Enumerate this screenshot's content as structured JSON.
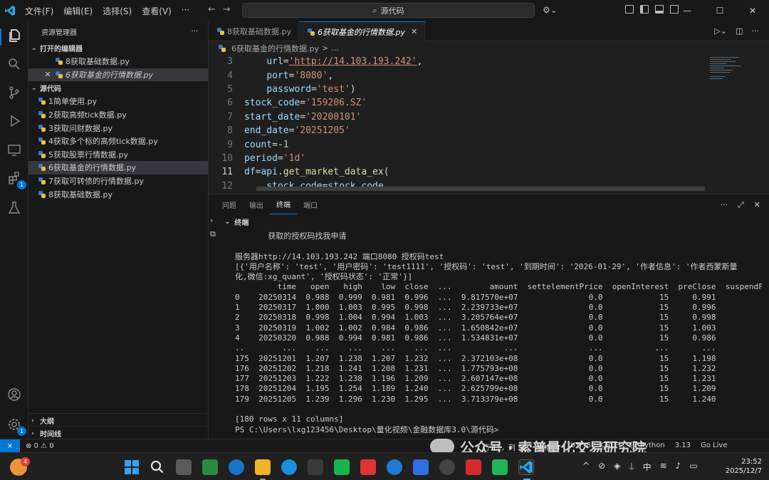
{
  "titlebar": {
    "menu": [
      "文件(F)",
      "编辑(E)",
      "选择(S)",
      "查看(V)",
      "···"
    ],
    "search_text": "源代码",
    "win_controls": [
      "—",
      "☐",
      "✕"
    ]
  },
  "sidebar": {
    "title": "资源管理器",
    "more": "···",
    "open_editors_label": "打开的编辑器",
    "open_editors": [
      {
        "name": "8获取基础数据.py"
      },
      {
        "name": "6获取基金的行情数据.py"
      }
    ],
    "folder_label": "源代码",
    "files": [
      "1简单使用.py",
      "2获取高频tick数据.py",
      "3获取问财数据.py",
      "4获取多个标的高频tick数据.py",
      "5获取股票行情数据.py",
      "6获取基金的行情数据.py",
      "7获取可转债的行情数据.py",
      "8获取基础数据.py"
    ],
    "outline_label": "大纲",
    "timeline_label": "时间线",
    "badges": {
      "extensions": "1",
      "settings": "1"
    }
  },
  "tabs": [
    {
      "label": "8获取基础数据.py",
      "active": false
    },
    {
      "label": "6获取基金的行情数据.py",
      "active": true,
      "close": "✕"
    }
  ],
  "breadcrumb": {
    "file": "6获取基金的行情数据.py",
    "sep": ">",
    "rest": "..."
  },
  "editor": {
    "lines": [
      {
        "n": "3",
        "indent": "    ",
        "parts": [
          [
            "var",
            "url"
          ],
          [
            "op",
            "="
          ],
          [
            "url",
            "'http://14.103.193.242'"
          ],
          [
            "op",
            ","
          ]
        ]
      },
      {
        "n": "4",
        "indent": "    ",
        "parts": [
          [
            "var",
            "port"
          ],
          [
            "op",
            "="
          ],
          [
            "str",
            "'8080'"
          ],
          [
            "op",
            ","
          ]
        ]
      },
      {
        "n": "5",
        "indent": "    ",
        "parts": [
          [
            "var",
            "password"
          ],
          [
            "op",
            "="
          ],
          [
            "str",
            "'test'"
          ],
          [
            "op",
            ")"
          ]
        ]
      },
      {
        "n": "6",
        "indent": "",
        "parts": [
          [
            "var",
            "stock_code"
          ],
          [
            "op",
            "="
          ],
          [
            "str",
            "'159206.SZ'"
          ]
        ]
      },
      {
        "n": "7",
        "indent": "",
        "parts": [
          [
            "var",
            "start_date"
          ],
          [
            "op",
            "="
          ],
          [
            "str",
            "'20200101'"
          ]
        ]
      },
      {
        "n": "8",
        "indent": "",
        "parts": [
          [
            "var",
            "end_date"
          ],
          [
            "op",
            "="
          ],
          [
            "str",
            "'20251205'"
          ]
        ]
      },
      {
        "n": "9",
        "indent": "",
        "parts": [
          [
            "var",
            "count"
          ],
          [
            "op",
            "=-"
          ],
          [
            "num",
            "1"
          ]
        ]
      },
      {
        "n": "10",
        "indent": "",
        "parts": [
          [
            "var",
            "period"
          ],
          [
            "op",
            "="
          ],
          [
            "str",
            "'1d'"
          ]
        ]
      },
      {
        "n": "11",
        "indent": "",
        "parts": [
          [
            "var",
            "df"
          ],
          [
            "op",
            "="
          ],
          [
            "var",
            "api"
          ],
          [
            "op",
            "."
          ],
          [
            "fn",
            "get_market_data_ex"
          ],
          [
            "op",
            "("
          ]
        ],
        "current": true
      },
      {
        "n": "12",
        "indent": "    ",
        "parts": [
          [
            "var",
            "stock_code"
          ],
          [
            "op",
            "="
          ],
          [
            "var",
            "stock_code"
          ],
          [
            "op",
            ","
          ]
        ]
      }
    ]
  },
  "panel": {
    "tabs": [
      "问题",
      "输出",
      "终端",
      "端口"
    ],
    "active_tab": "终端",
    "terminal_label": "终端",
    "terminal_lines": [
      "       获取的授权码找我申请",
      "",
      "服务器http://14.103.193.242 端口8080 授权码test",
      "[{'用户名称': 'test', '用户密码': 'test1111', '授权码': 'test', '到期时间': '2026-01-29', '作者信息': '作者西蒙斯量",
      "化,微信:xg_quant', '授权码状态': '正常'}]",
      "         time   open   high    low  close  ...        amount  settelementPrice  openInterest  preClose  suspendFlag",
      "0    20250314  0.988  0.999  0.981  0.996  ...  9.817570e+07               0.0            15     0.991            0",
      "1    20250317  1.000  1.003  0.995  0.998  ...  2.239733e+07               0.0            15     0.996            0",
      "2    20250318  0.998  1.004  0.994  1.003  ...  3.205764e+07               0.0            15     0.998            0",
      "3    20250319  1.002  1.002  0.984  0.986  ...  1.650842e+07               0.0            15     1.003            0",
      "4    20250320  0.988  0.994  0.981  0.986  ...  1.534831e+07               0.0            15     0.986            0",
      "..        ...    ...    ...    ...    ...  ...           ...               ...           ...       ...          ...",
      "175  20251201  1.207  1.238  1.207  1.232  ...  2.372103e+08               0.0            15     1.198            0",
      "176  20251202  1.218  1.241  1.208  1.231  ...  1.775793e+08               0.0            15     1.232            0",
      "177  20251203  1.222  1.238  1.196  1.209  ...  2.607147e+08               0.0            15     1.231            0",
      "178  20251204  1.195  1.254  1.189  1.240  ...  2.625799e+08               0.0            15     1.209            0",
      "179  20251205  1.239  1.296  1.230  1.295  ...  3.713379e+08               0.0            15     1.240            0",
      "",
      "[180 rows x 11 columns]",
      "PS C:\\Users\\lxg123456\\Desktop\\量化视频\\金融数据库3.0\\源代码>"
    ]
  },
  "statusbar": {
    "remote": "⨯",
    "problems": "⊗ 0 ⚠ 0",
    "right_items": [
      "行 11，列 22",
      "空格: 4",
      "UTF-8",
      "CRLF",
      "{} Python",
      "3.13",
      "Go Live"
    ]
  },
  "watermark": {
    "text": "公众号 · 索普量化交易研究院"
  },
  "taskbar": {
    "weather_badge": "4",
    "tray": [
      "^",
      "中"
    ],
    "time": "23:52",
    "date": "2025/12/7"
  },
  "colors": {
    "accent": "#0078d4",
    "background": "#1f1f1f",
    "sidebar": "#181818"
  }
}
